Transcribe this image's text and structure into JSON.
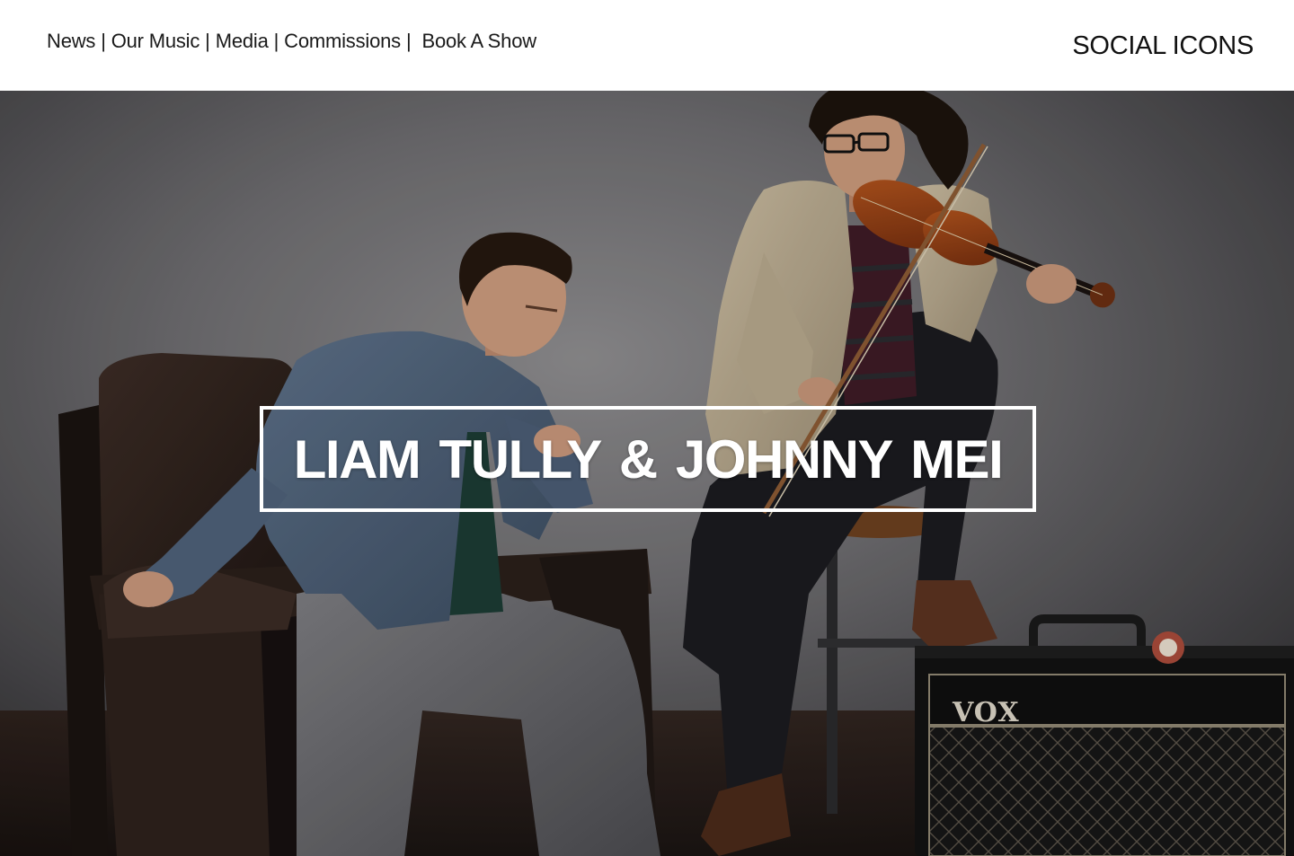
{
  "nav": {
    "items": [
      {
        "label": "News"
      },
      {
        "label": "Our Music"
      },
      {
        "label": "Media"
      },
      {
        "label": "Commissions"
      },
      {
        "label": "Book A Show"
      }
    ],
    "separator": "|"
  },
  "header": {
    "social_label": "SOCIAL ICONS"
  },
  "hero": {
    "title": "LIAM TULLY &  JOHNNY MEI",
    "amp_brand": "VOX"
  },
  "colors": {
    "header_bg": "#ffffff",
    "nav_text": "#1a1a1a",
    "title_text": "#ffffff",
    "title_border": "#ffffff"
  }
}
